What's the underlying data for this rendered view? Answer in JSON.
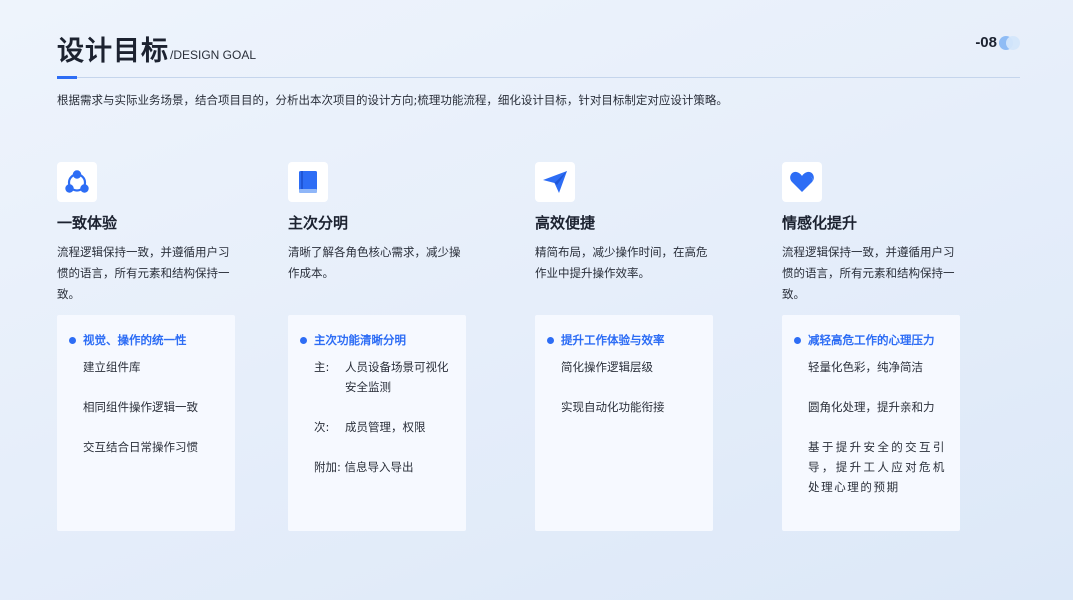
{
  "header": {
    "title": "设计目标",
    "subtitle": "/DESIGN GOAL",
    "page_number": "-08"
  },
  "description": "根据需求与实际业务场景，结合项目目的，分析出本次项目的设计方向;梳理功能流程，细化设计目标，针对目标制定对应设计策略。",
  "colors": {
    "accent": "#2d6df5"
  },
  "columns": [
    {
      "icon": "team-icon",
      "title": "一致体验",
      "text": "流程逻辑保持一致，并遵循用户习惯的语言，所有元素和结构保持一致。",
      "card": {
        "title": "视觉、操作的统一性",
        "items": [
          "建立组件库",
          "相同组件操作逻辑一致",
          "交互结合日常操作习惯"
        ]
      }
    },
    {
      "icon": "book-icon",
      "title": "主次分明",
      "text": "清晰了解各角色核心需求，减少操作成本。",
      "card": {
        "title": "主次功能清晰分明",
        "items": [
          {
            "key": "主:",
            "value": "人员设备场景可视化安全监测"
          },
          {
            "key": "次:",
            "value": "成员管理，权限"
          },
          {
            "key": "附加:",
            "value": "信息导入导出"
          }
        ]
      }
    },
    {
      "icon": "paper-plane-icon",
      "title": "高效便捷",
      "text": "精简布局，减少操作时间，在高危作业中提升操作效率。",
      "card": {
        "title": "提升工作体验与效率",
        "items": [
          "简化操作逻辑层级",
          "实现自动化功能衔接"
        ]
      }
    },
    {
      "icon": "heart-icon",
      "title": "情感化提升",
      "text": "流程逻辑保持一致，并遵循用户习惯的语言，所有元素和结构保持一致。",
      "card": {
        "title": "减轻高危工作的心理压力",
        "items": [
          "轻量化色彩，纯净简洁",
          "圆角化处理，提升亲和力",
          "基于提升安全的交互引导，提升工人应对危机处理心理的预期"
        ]
      }
    }
  ]
}
